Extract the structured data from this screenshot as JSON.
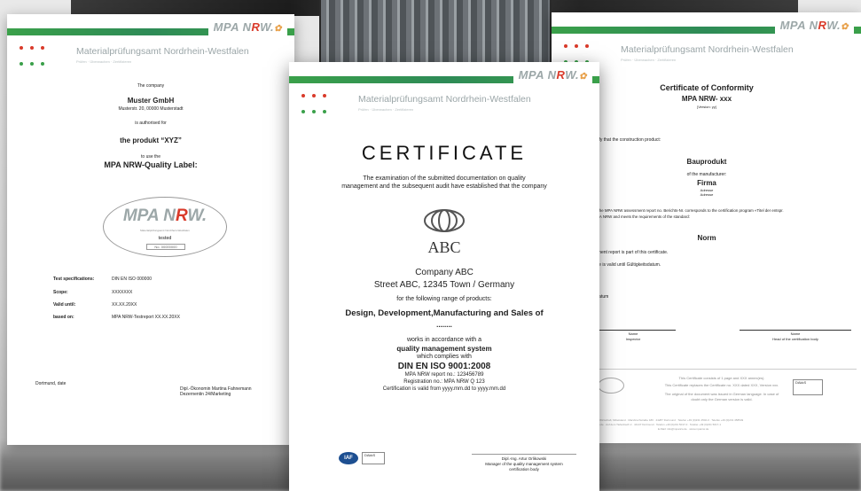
{
  "header": {
    "logo_mpa": "MPA N",
    "logo_r": "R",
    "logo_w": "W.",
    "logo_sym": "✿",
    "institute": "Materialprüfungsamt Nordrhein-Westfalen",
    "institute_sub": "Prüfen · Überwachen · Zertifizieren"
  },
  "left_doc": {
    "the_company": "The company",
    "company_name": "Muster GmbH",
    "company_address": "Musterstr. 20, 00000 Musterstadt",
    "authorised_for": "is authorised for",
    "product": "the produkt “XYZ”",
    "to_use_the": "to use the",
    "label_title": "MPA NRW-Quality Label:",
    "badge_logo": "MPA NRW.",
    "badge_line": "Materialprüfungsamt Nordrhein-Westfalen",
    "badge_tested": "tested",
    "badge_no": "No. 00000000",
    "rows": [
      {
        "key": "Test specifications:",
        "value": "DIN EN ISO 000000"
      },
      {
        "key": "Scope:",
        "value": "XXXXXXX"
      },
      {
        "key": "Valid until:",
        "value": "XX.XX.20XX"
      },
      {
        "key": "based on:",
        "value": "MPA NRW-Testreport XX.XX.20XX"
      }
    ],
    "place_date": "Dortmund, date",
    "signer_name": "Dipl.-Ökonomin Martina Fahnemann",
    "signer_dept": "Dezernentin 24/Marketing"
  },
  "center_doc": {
    "title": "CERTIFICATE",
    "intro_1": "The examination of the submitted documentation on quality",
    "intro_2": "management and the subsequent audit have established that the company",
    "logo_text": "ABC",
    "company": "Company ABC",
    "address": "Street ABC, 12345 Town / Germany",
    "range_intro": "for the following range of products:",
    "range": "Design, Development,Manufacturing and Sales of",
    "dots": "........",
    "works": "works in accordance with a",
    "qms": "quality management system",
    "complies": "which complies with",
    "standard": "DIN EN ISO 9001:2008",
    "report_no": "MPA NRW report no.: 123456789",
    "reg_no": "Registration no.: MPA NRW Q 123",
    "validity": "Certification is valid from yyyy.mm.dd  to  yyyy.mm.dd",
    "iaf": "IAF",
    "dakks": "DAkkS",
    "signer_name": "Dipl.-Ing. Artur Orlikowski",
    "signer_role_1": "Manager of the quality management system",
    "signer_role_2": "certification body"
  },
  "right_doc": {
    "title": "Certificate of Conformity",
    "subtitle": "MPA NRW- xxx",
    "version": "[Version: yy]",
    "certify": "certify that the construction product:",
    "product": "Bauprodukt",
    "of_manufacturer": "of the manufacturer:",
    "firma": "Firma",
    "adresse_1": "Adresse",
    "adresse_2": "Adresse",
    "report_line_1": "g to the MPA NRW assessment report no. Berichts-Nr. corresponds to the certification program «Titel der entspr.",
    "report_line_2": "e MPA NRW and meets the requirements of the standard:",
    "norm": "Norm",
    "part_of": "essment report is part of this certificate.",
    "valid_until": "ficate is valid until Gültigkeitsdatum.",
    "place_date": "d, Datum",
    "sig_left_name": "Name",
    "sig_left_role": "Inspector",
    "sig_right_name": "Name",
    "sig_right_role": "Head of the certification body",
    "note_1": "This Certificate consists of 1 page and XXX annex(es).",
    "note_2": "This Certificate replaces the Certificate no. XXX dated XXX, Version xxx.",
    "note_3": "The original of the document was issued in German language. In case of",
    "note_4": "doubt only the German version is valid.",
    "footer_1": "ung für Wirtschaft, Mittelstand · Marsbruchstraße 186 · 44287 Dortmund · Telefon +49 (0)231 4502-0 · Telefax +49 (0)231 458549",
    "footer_2": "mpanrw.de · Auf dem Tiefenbach 2 · 44147 Dortmund · Telefon +49 (0)231 5017-0 · Telefax +49 (0)231 5017-1",
    "footer_3": "E-Mail: info@mpanrw.de · www.mpanrw.de"
  }
}
